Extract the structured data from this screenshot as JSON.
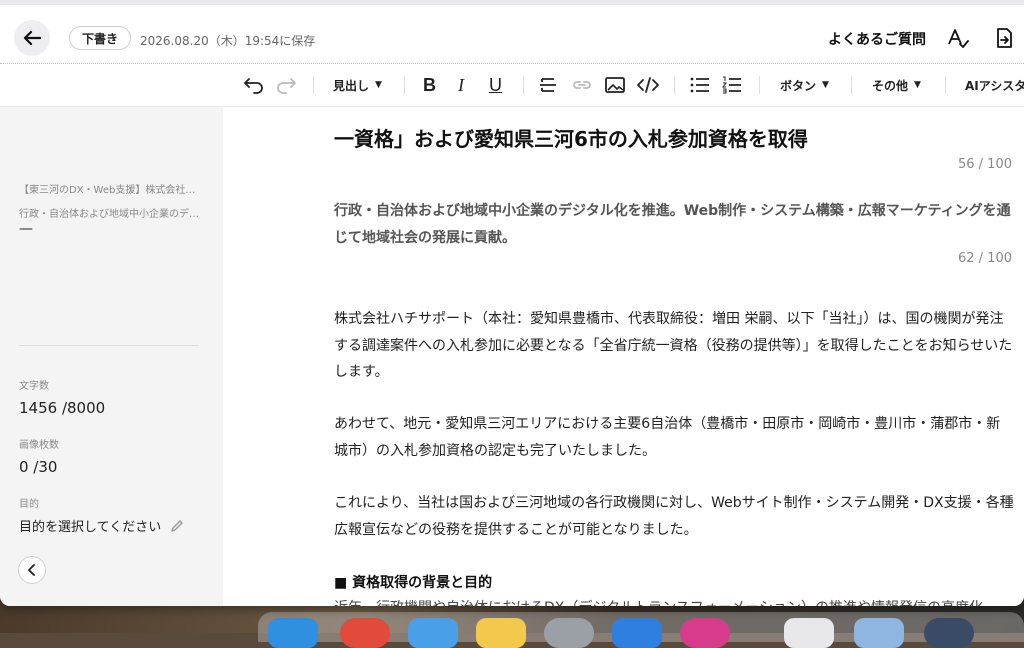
{
  "header": {
    "status_badge": "下書き",
    "saved_text": "2026.08.20（木）19:54に保存",
    "faq": "よくあるご質問"
  },
  "toolbar": {
    "heading_dropdown": "見出し",
    "button_dropdown": "ボタン",
    "more_dropdown": "その他",
    "ai_assistant": "AIアシスタ"
  },
  "sidebar": {
    "article_title": "【東三河のDX・Web支援】株式会社…",
    "article_desc": "行政・自治体および地域中小企業のデ…",
    "dash": "—",
    "char_count_label": "文字数",
    "char_count": "1456 /8000",
    "image_count_label": "画像枚数",
    "image_count": "0 /30",
    "purpose_label": "目的",
    "purpose_value": "目的を選択してください"
  },
  "editor": {
    "title": "一資格」および愛知県三河6市の入札参加資格を取得",
    "title_counter": "56 / 100",
    "subtitle": "行政・自治体および地域中小企業のデジタル化を推進。Web制作・システム構築・広報マーケティングを通じて地域社会の発展に貢献。",
    "subtitle_counter": "62 / 100",
    "paragraph1": "株式会社ハチサポート（本社：愛知県豊橋市、代表取締役：増田 栄嗣、以下「当社」）は、国の機関が発注する調達案件への入札参加に必要となる「全省庁統一資格（役務の提供等）」を取得したことをお知らせいたします。",
    "paragraph2": "あわせて、地元・愛知県三河エリアにおける主要6自治体（豊橋市・田原市・岡崎市・豊川市・蒲郡市・新城市）の入札参加資格の認定も完了いたしました。",
    "paragraph3": "これにより、当社は国および三河地域の各行政機関に対し、Webサイト制作・システム開発・DX支援・各種広報宣伝などの役務を提供することが可能となりました。",
    "section_heading": "■ 資格取得の背景と目的",
    "cut_line": "近年、行政機関や自治体におけるDX（デジタルトランスフォーメーション）の推進や情報発信の高度化"
  },
  "colors": {
    "accent": "#111111",
    "sidebar_bg": "#f4f4f5"
  }
}
